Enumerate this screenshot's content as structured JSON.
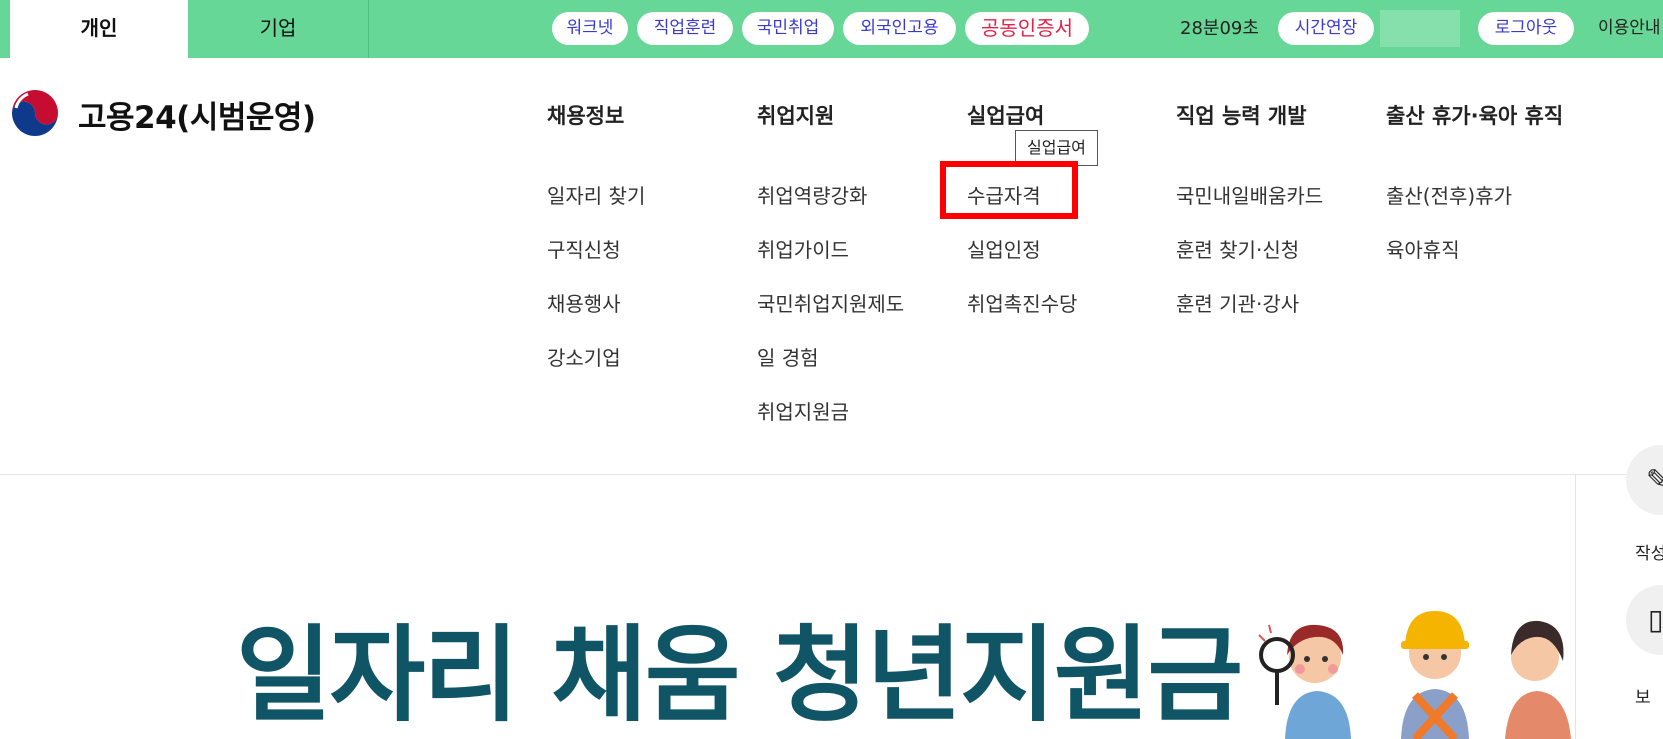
{
  "topbar": {
    "tabs": [
      {
        "label": "개인",
        "active": true
      },
      {
        "label": "기업",
        "active": false
      }
    ],
    "quick_links": [
      "워크넷",
      "직업훈련",
      "국민취업",
      "외국인고용"
    ],
    "cert_link": "공동인증서",
    "session_time": "28분09초",
    "extend_label": "시간연장",
    "logout_label": "로그아웃",
    "guide_label": "이용안내",
    "colors": {
      "bar": "#66d796",
      "link": "#3a3ad0",
      "cert": "#e0244a"
    }
  },
  "header": {
    "site_name": "고용24(시범운영)"
  },
  "menu": {
    "columns": [
      {
        "title": "채용정보",
        "items": [
          "일자리 찾기",
          "구직신청",
          "채용행사",
          "강소기업"
        ]
      },
      {
        "title": "취업지원",
        "items": [
          "취업역량강화",
          "취업가이드",
          "국민취업지원제도",
          "일 경험",
          "취업지원금"
        ]
      },
      {
        "title": "실업급여",
        "items": [
          "수급자격",
          "실업인정",
          "취업촉진수당"
        ]
      },
      {
        "title": "직업 능력 개발",
        "items": [
          "국민내일배움카드",
          "훈련 찾기·신청",
          "훈련 기관·강사"
        ]
      },
      {
        "title": "출산 휴가·육아 휴직",
        "items": [
          "출산(전후)휴가",
          "육아휴직"
        ]
      }
    ],
    "tooltip": "실업급여",
    "highlighted_item": "수급자격",
    "highlight_color": "#ff0000"
  },
  "sidebar": {
    "items": [
      {
        "label": "작성",
        "icon": "pencil-icon"
      },
      {
        "label": "보",
        "icon": "document-icon"
      }
    ]
  },
  "banner": {
    "title": "일자리 채움 청년지원금",
    "title_color": "#0f5566"
  }
}
